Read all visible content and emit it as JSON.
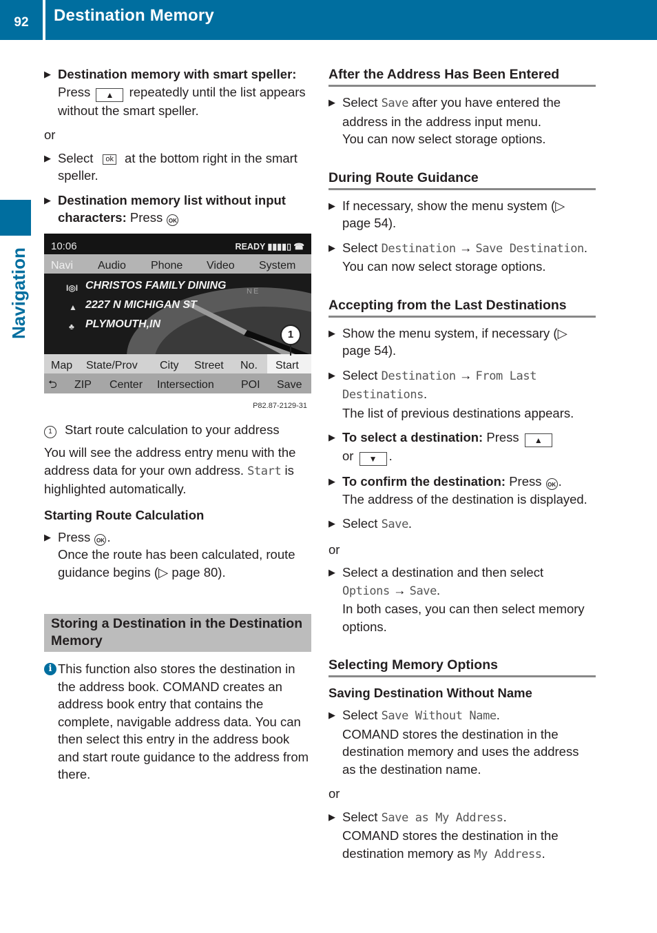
{
  "header": {
    "page_number": "92",
    "title": "Destination Memory"
  },
  "side_label": "Navigation",
  "left": {
    "step1_bold": "Destination memory with smart speller:",
    "step1_a": "Press",
    "step1_key": "▲",
    "step1_b": "repeatedly until the list appears without the smart speller.",
    "or1": "or",
    "step2_a": "Select",
    "step2_ok": "ok",
    "step2_b": "at the bottom right in the smart speller.",
    "step3_bold": "Destination memory list without input characters:",
    "step3_a": "Press",
    "ok_label": "OK",
    "screen": {
      "time": "10:06",
      "status": "READY ▮▮▮▮▯ ☎",
      "top_menu": [
        "Navi",
        "Audio",
        "Phone",
        "Video",
        "System"
      ],
      "entries": [
        {
          "icon": "restaurant-icon",
          "glyph": "I◎I",
          "text": "CHRISTOS FAMILY DINING"
        },
        {
          "icon": "street-icon",
          "glyph": "▲",
          "text": "2227 N MICHIGAN ST"
        },
        {
          "icon": "city-icon",
          "glyph": "♣",
          "text": "PLYMOUTH,IN"
        }
      ],
      "compass_label": "NE",
      "row1": [
        "Map",
        "State/Prov",
        "City",
        "Street",
        "No.",
        "Start"
      ],
      "row2": [
        "⮌",
        "ZIP",
        "Center",
        "Intersection",
        "POI",
        "Save"
      ],
      "callout": "1",
      "image_code": "P82.87-2129-31"
    },
    "legend_num": "1",
    "legend_text": "Start route calculation to your address",
    "para_a": "You will see the address entry menu with the address data for your own address.",
    "para_mono": "Start",
    "para_b": "is highlighted automatically.",
    "h_start": "Starting Route Calculation",
    "step4_a": "Press",
    "step4_b": ".",
    "step4_c": "Once the route has been calculated, route guidance begins (▷ page 80).",
    "section_title": "Storing a Destination in the Destination Memory",
    "info_icon": "i",
    "info_text": "This function also stores the destination in the address book. COMAND creates an address book entry that contains the complete, navigable address data. You can then select this entry in the address book and start route guidance to the address from there."
  },
  "right": {
    "h_after": "After the Address Has Been Entered",
    "after_a": "Select",
    "after_mono": "Save",
    "after_b": "after you have entered the address in the address input menu.",
    "after_c": "You can now select storage options.",
    "h_during": "During Route Guidance",
    "during1": "If necessary, show the menu system (▷ page 54).",
    "during2_a": "Select",
    "during2_mono1": "Destination",
    "arrow": "→",
    "during2_mono2": "Save Destination",
    "during2_c": "You can now select storage options.",
    "h_accept": "Accepting from the Last Destinations",
    "accept1": "Show the menu system, if necessary (▷ page 54).",
    "accept2_a": "Select",
    "accept2_mono1": "Destination",
    "accept2_mono2": "From Last Destinations",
    "accept2_c": "The list of previous destinations appears.",
    "accept3_bold": "To select a destination:",
    "accept3_a": "Press",
    "key_up": "▲",
    "or_word": "or",
    "key_down": "▼",
    "accept4_bold": "To confirm the destination:",
    "accept4_a": "Press",
    "ok_label": "OK",
    "accept4_c": "The address of the destination is displayed.",
    "accept5_a": "Select",
    "accept5_mono": "Save",
    "or2": "or",
    "accept6_a": "Select a destination and then select",
    "accept6_mono1": "Options",
    "accept6_mono2": "Save",
    "accept6_c": "In both cases, you can then select memory options.",
    "h_select": "Selecting Memory Options",
    "h_without": "Saving Destination Without Name",
    "sel1_a": "Select",
    "sel1_mono": "Save Without Name",
    "sel1_c": "COMAND stores the destination in the destination memory and uses the address as the destination name.",
    "or3": "or",
    "sel2_a": "Select",
    "sel2_mono": "Save as My Address",
    "sel2_c": "COMAND stores the destination in the destination memory as",
    "sel2_mono2": "My Address"
  }
}
